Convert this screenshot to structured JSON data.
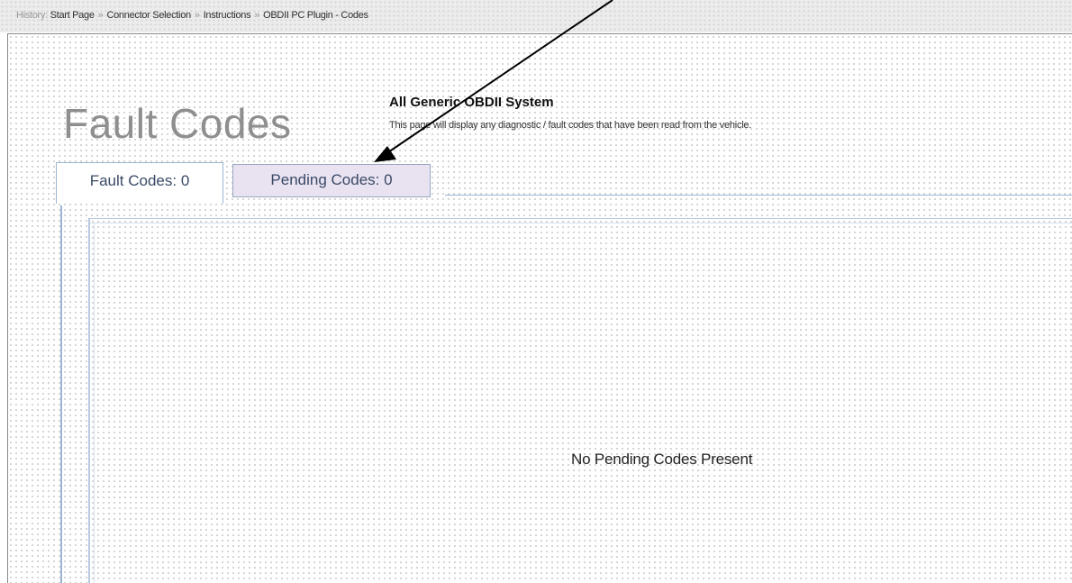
{
  "breadcrumb": {
    "label": "History:",
    "items": [
      "Start Page",
      "Connector Selection",
      "Instructions",
      "OBDII PC Plugin - Codes"
    ],
    "separator": "»"
  },
  "header": {
    "title": "Fault Codes",
    "system_name": "All Generic OBDII System",
    "description": "This page will display any diagnostic / fault codes that have been read from the vehicle."
  },
  "tabs": [
    {
      "label": "Fault Codes: 0",
      "selected": true
    },
    {
      "label": "Pending Codes: 0",
      "selected": false
    }
  ],
  "content": {
    "message": "No Pending Codes Present"
  },
  "colors": {
    "tab_border": "#9db5d4",
    "pending_tab_bg": "#e9e2f1",
    "title_gray": "#8f8f8f"
  },
  "icons": {
    "annotation": "arrow-icon"
  }
}
